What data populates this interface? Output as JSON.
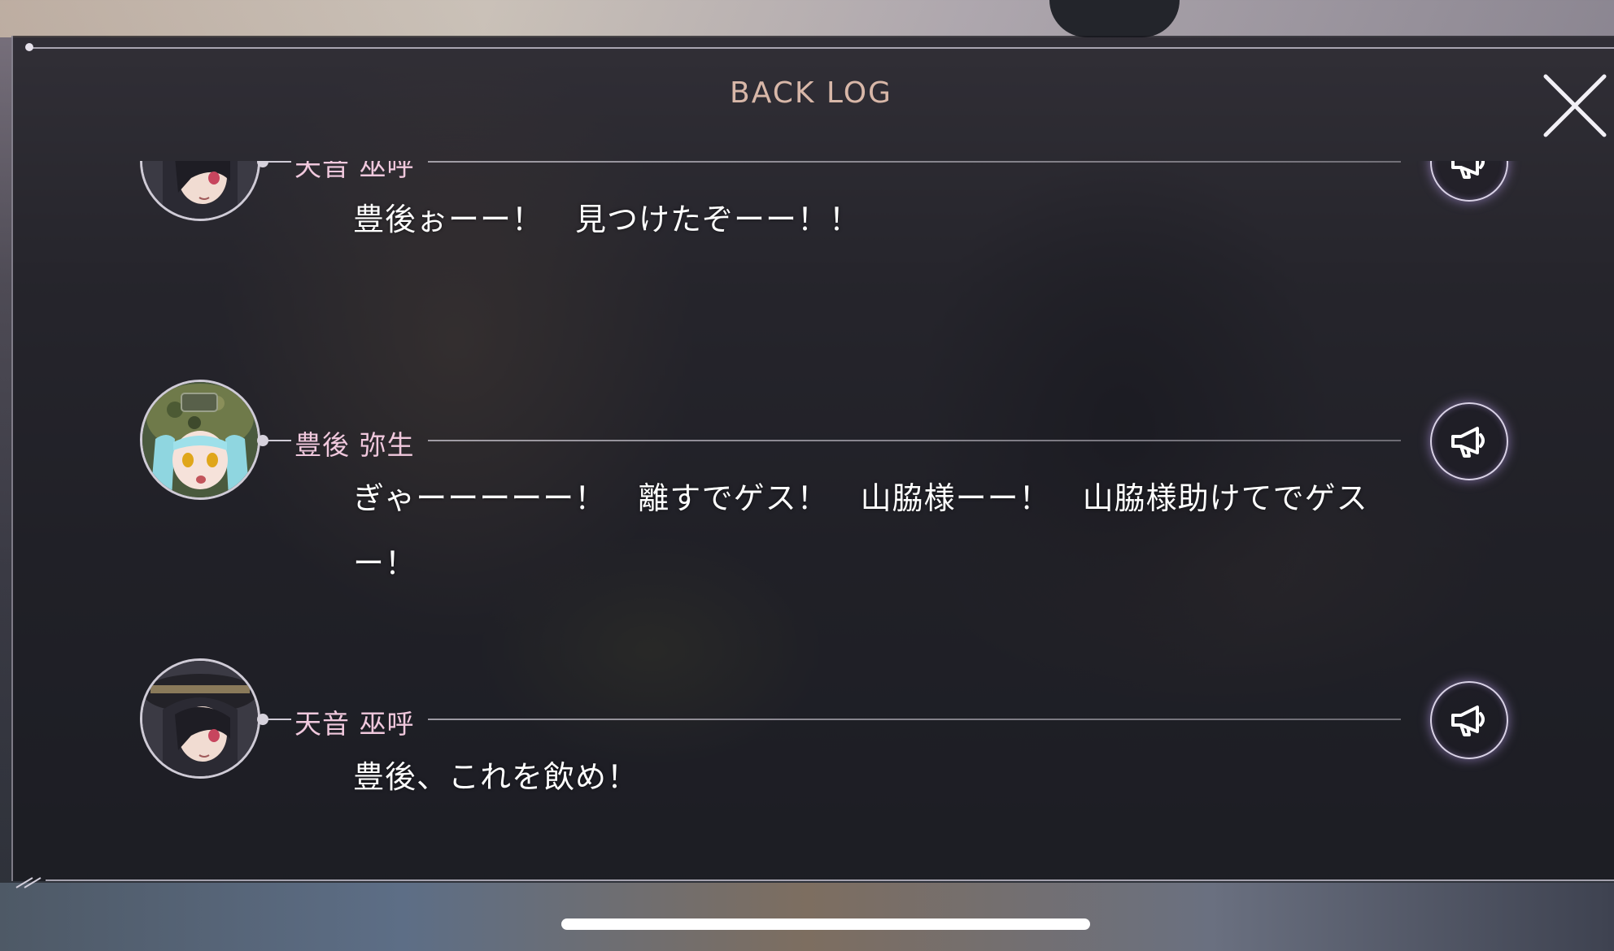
{
  "header": {
    "title": "BACK LOG"
  },
  "icons": {
    "close": "close-icon",
    "voice": "megaphone-icon"
  },
  "colors": {
    "title": "#d8b7a8",
    "speaker_name": "#f0c8dd",
    "message": "#ffffff",
    "panel_bg": "rgba(22,22,28,0.72)",
    "voice_glow": "#c8aaff"
  },
  "log": {
    "entries": [
      {
        "speaker": "天音 巫呼",
        "message": "豊後ぉーー！　見つけたぞーー！！",
        "avatar": "amane-miko-avatar"
      },
      {
        "speaker": "豊後 弥生",
        "message": "ぎゃーーーーー！　離すでゲス！　山脇様ーー！　山脇様助けてでゲスー！",
        "avatar": "bungo-yayoi-avatar"
      },
      {
        "speaker": "天音 巫呼",
        "message": "豊後、これを飲め！",
        "avatar": "amane-miko-avatar"
      }
    ]
  }
}
